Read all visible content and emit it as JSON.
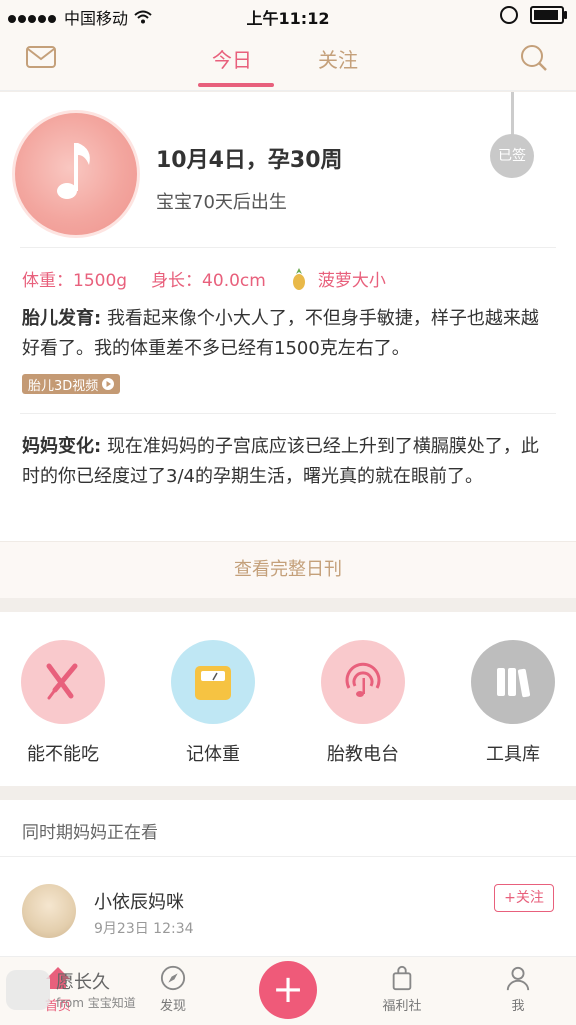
{
  "status_bar": {
    "carrier": "中国移动",
    "time": "上午11:12"
  },
  "top_nav": {
    "tabs": [
      {
        "label": "今日",
        "active": true
      },
      {
        "label": "关注",
        "active": false
      }
    ]
  },
  "today": {
    "date_title": "10月4日，孕30周",
    "due_text": "宝宝70天后出生",
    "sign_label": "已签",
    "weight": "体重：1500g",
    "length": "身长：40.0cm",
    "size_compare": "菠萝大小",
    "fetal_label": "胎儿发育:",
    "fetal_text": "我看起来像个小大人了，不但身手敏捷，样子也越来越好看了。我的体重差不多已经有1500克左右了。",
    "video_label": "胎儿3D视频",
    "mom_label": "妈妈变化:",
    "mom_text": "现在准妈妈的子宫底应该已经上升到了横膈膜处了，此时的你已经度过了3/4的孕期生活，曙光真的就在眼前了。",
    "more_label": "查看完整日刊"
  },
  "tools": [
    {
      "label": "能不能吃",
      "icon": "fork-knife-icon",
      "color": "#f9c9cc"
    },
    {
      "label": "记体重",
      "icon": "scale-icon",
      "color": "#bfe7f4"
    },
    {
      "label": "胎教电台",
      "icon": "radio-music-icon",
      "color": "#f9c9cc"
    },
    {
      "label": "工具库",
      "icon": "books-icon",
      "color": "#bdbdbd"
    }
  ],
  "feed": {
    "header": "同时期妈妈正在看",
    "user_name": "小依辰妈咪",
    "user_time": "9月23日 12:34",
    "follow_label": "+关注"
  },
  "bottom_nav": {
    "home": "首页",
    "discover": "发现",
    "add": "+",
    "welfare": "福利社",
    "me": "我"
  },
  "watermark": {
    "line1": "愿长久",
    "line2": "from 宝宝知道"
  },
  "colors": {
    "accent": "#e8607c",
    "gold": "#c4a07a",
    "background": "#fbf8f4"
  }
}
